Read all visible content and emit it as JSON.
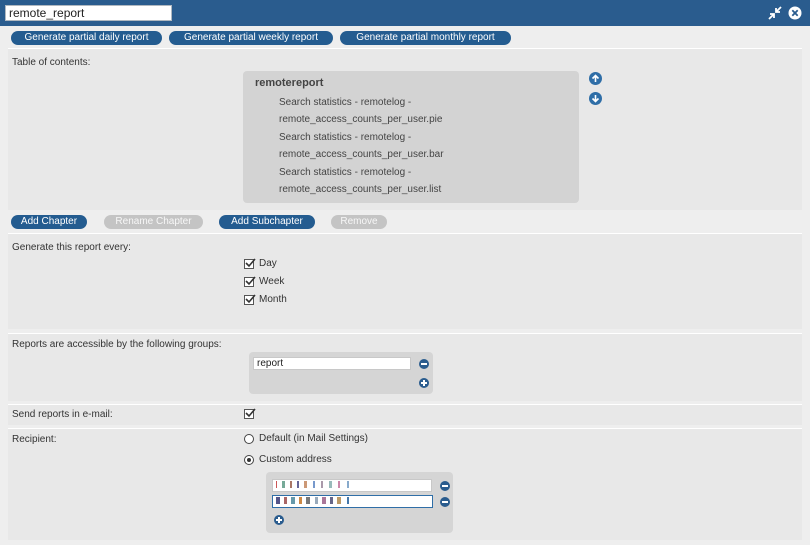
{
  "window": {
    "title_value": "remote_report"
  },
  "top_buttons": {
    "daily": "Generate partial daily report",
    "weekly": "Generate partial weekly report",
    "monthly": "Generate partial monthly report"
  },
  "toc": {
    "label": "Table of contents:",
    "root": "remotereport",
    "items": [
      {
        "line1": "Search statistics - remotelog -",
        "line2": "remote_access_counts_per_user.pie"
      },
      {
        "line1": "Search statistics - remotelog -",
        "line2": "remote_access_counts_per_user.bar"
      },
      {
        "line1": "Search statistics - remotelog -",
        "line2": "remote_access_counts_per_user.list"
      }
    ]
  },
  "chapter_buttons": {
    "add_chapter": "Add Chapter",
    "rename_chapter": "Rename Chapter",
    "add_subchapter": "Add Subchapter",
    "remove": "Remove"
  },
  "schedule": {
    "label": "Generate this report every:",
    "options": [
      {
        "label": "Day",
        "checked": true
      },
      {
        "label": "Week",
        "checked": true
      },
      {
        "label": "Month",
        "checked": true
      }
    ]
  },
  "groups": {
    "label": "Reports are accessible by the following groups:",
    "values": [
      "report"
    ]
  },
  "email": {
    "label": "Send reports in e-mail:",
    "checked": true
  },
  "recipient": {
    "label": "Recipient:",
    "default_option": "Default (in Mail Settings)",
    "custom_option": "Custom address",
    "selected": "custom"
  },
  "icons": {
    "collapse": "collapse-arrows-icon",
    "close": "close-icon",
    "up": "arrow-up-icon",
    "down": "arrow-down-icon",
    "minus": "minus-icon",
    "plus": "plus-icon"
  },
  "colors": {
    "titlebar": "#2a5c8e",
    "primary_button": "#245c90",
    "disabled_button": "#c4c4c4"
  }
}
